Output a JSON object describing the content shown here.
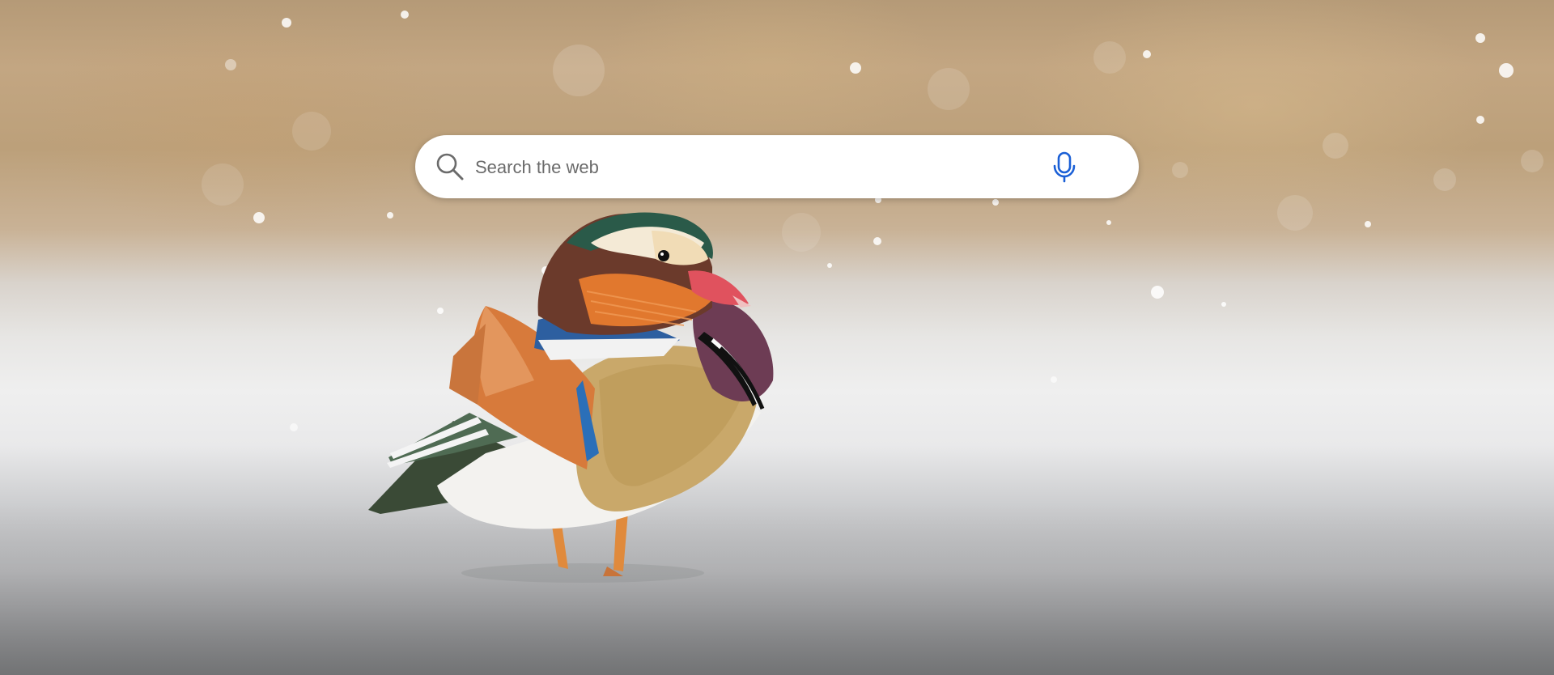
{
  "search": {
    "placeholder": "Search the web",
    "value": ""
  },
  "icons": {
    "search": "search-icon",
    "microphone": "microphone-icon"
  },
  "colors": {
    "mic_accent": "#1a5fd6",
    "search_icon": "#6b6b6b"
  }
}
